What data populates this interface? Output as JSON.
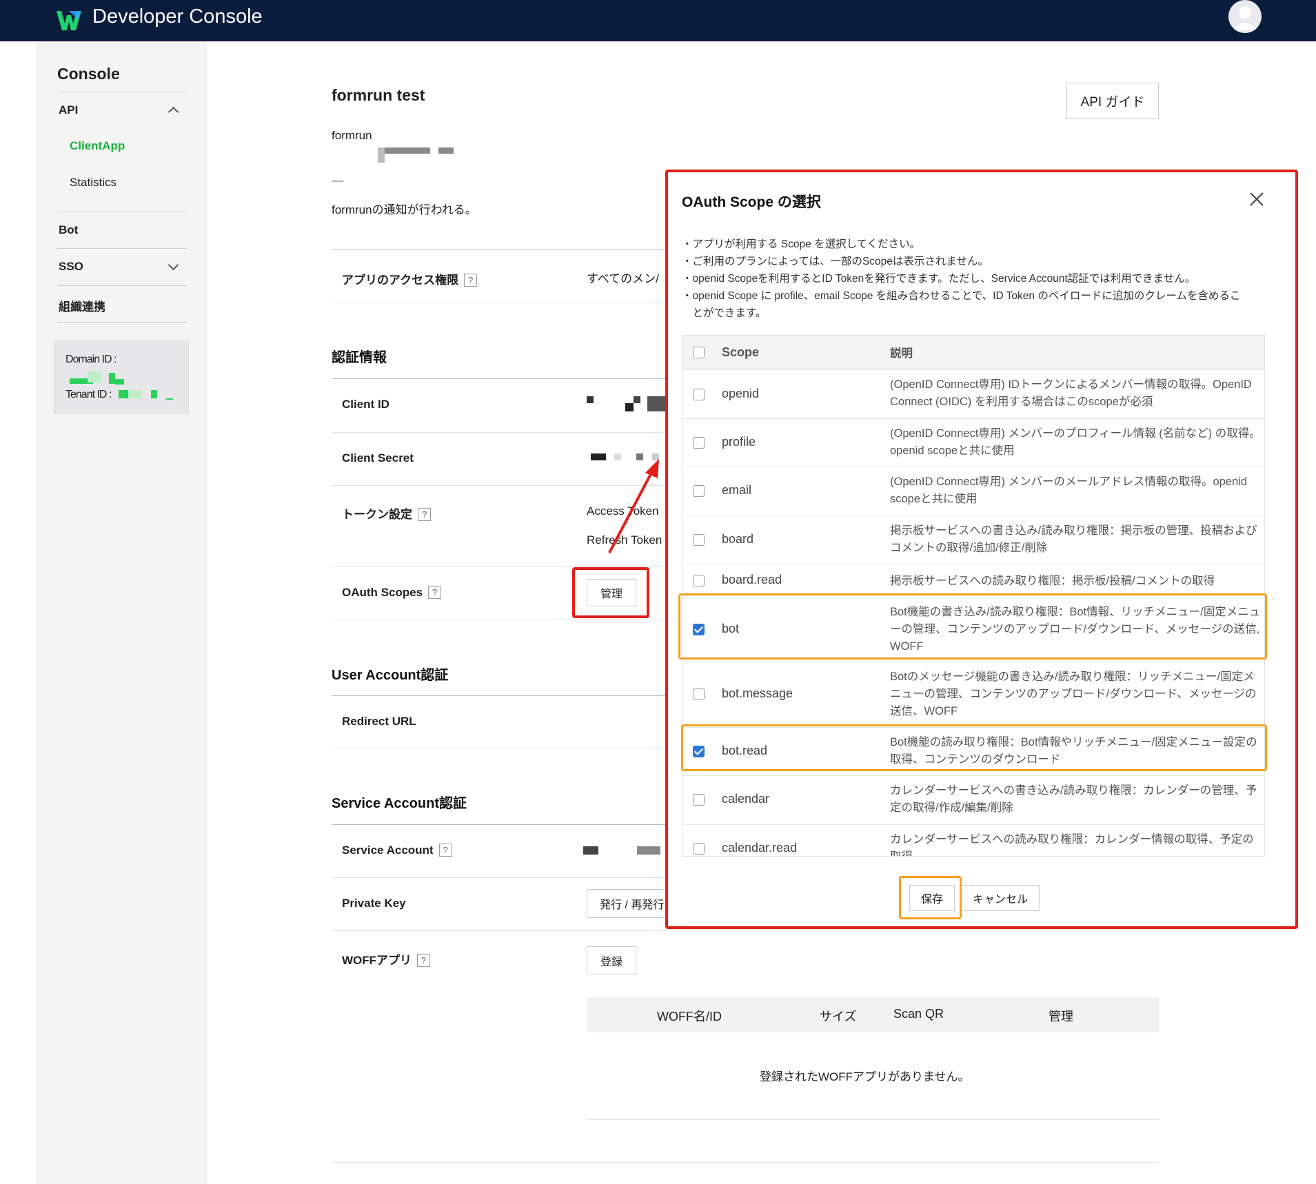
{
  "header": {
    "title": "Developer Console",
    "brand_color": "#0b1d3d",
    "logo_icon": "works-logo-icon",
    "avatar_icon": "user-avatar-icon"
  },
  "sidebar": {
    "title": "Console",
    "api": "API",
    "client_app": "ClientApp",
    "statistics": "Statistics",
    "bot": "Bot",
    "sso": "SSO",
    "org_link": "組織連携",
    "domain_id_label": "Domain ID :",
    "tenant_id_label": "Tenant ID :",
    "active_color": "#19b23b"
  },
  "app": {
    "name": "formrun test",
    "developer": "formrun",
    "dash": "—",
    "description": "formrunの通知が行われる。",
    "api_guide": "API ガイド"
  },
  "access": {
    "label": "アプリのアクセス権限",
    "value": "すべてのメン/"
  },
  "auth": {
    "title": "認証情報",
    "client_id": "Client ID",
    "client_secret": "Client Secret",
    "token_settings": "トークン設定",
    "access_token": "Access Token",
    "refresh_token": "Refresh Token",
    "oauth_scopes": "OAuth Scopes",
    "manage": "管理"
  },
  "user_account": {
    "title": "User Account認証",
    "redirect_url": "Redirect URL"
  },
  "service_account": {
    "title": "Service Account認証",
    "service_account": "Service Account",
    "private_key": "Private Key",
    "issue": "発行 / 再発行",
    "woff_app": "WOFFアプリ",
    "register": "登録"
  },
  "woff_table": {
    "columns": [
      "WOFF名/ID",
      "サイズ",
      "Scan QR",
      "管理"
    ],
    "empty": "登録されたWOFFアプリがありません。"
  },
  "modal": {
    "title": "OAuth Scope の選択",
    "notes": [
      "・アプリが利用する Scope を選択してください。",
      "・ご利用のプランによっては、一部のScopeは表示されません。",
      "・openid Scopeを利用するとID Tokenを発行できます。ただし、Service Account認証では利用できません。",
      "・openid Scope に profile、email Scope を組み合わせることで、ID Token のペイロードに追加のクレームを含めるこ",
      "　とができます。"
    ],
    "col_scope": "Scope",
    "col_desc": "説明",
    "rows": [
      {
        "scope": "openid",
        "checked": false,
        "desc": "(OpenID Connect専用) IDトークンによるメンバー情報の取得。OpenID Connect (OIDC) を利用する場合はこのscopeが必須"
      },
      {
        "scope": "profile",
        "checked": false,
        "desc": "(OpenID Connect専用) メンバーのプロフィール情報 (名前など) の取得。openid scopeと共に使用"
      },
      {
        "scope": "email",
        "checked": false,
        "desc": "(OpenID Connect専用) メンバーのメールアドレス情報の取得。openid scopeと共に使用"
      },
      {
        "scope": "board",
        "checked": false,
        "desc": "掲示板サービスへの書き込み/読み取り権限：掲示板の管理、投稿およびコメントの取得/追加/修正/削除"
      },
      {
        "scope": "board.read",
        "checked": false,
        "desc": "掲示板サービスへの読み取り権限：掲示板/投稿/コメントの取得"
      },
      {
        "scope": "bot",
        "checked": true,
        "desc": "Bot機能の書き込み/読み取り権限：Bot情報、リッチメニュー/固定メニューの管理、コンテンツのアップロード/ダウンロード、メッセージの送信, WOFF"
      },
      {
        "scope": "bot.message",
        "checked": false,
        "desc": "Botのメッセージ機能の書き込み/読み取り権限：リッチメニュー/固定メニューの管理、コンテンツのアップロード/ダウンロード、メッセージの送信、WOFF"
      },
      {
        "scope": "bot.read",
        "checked": true,
        "desc": "Bot機能の読み取り権限：Bot情報やリッチメニュー/固定メニュー設定の取得、コンテンツのダウンロード"
      },
      {
        "scope": "calendar",
        "checked": false,
        "desc": "カレンダーサービスへの書き込み/読み取り権限：カレンダーの管理、予定の取得/作成/編集/削除"
      },
      {
        "scope": "calendar.read",
        "checked": false,
        "desc": "カレンダーサービスへの読み取り権限：カレンダー情報の取得、予定の取得"
      }
    ],
    "save": "保存",
    "cancel": "キャンセル",
    "close_icon": "close-icon",
    "checkbox_color": "#2b77d6"
  },
  "annotations": {
    "red_color": "#e0201a",
    "orange_color": "#f5a020"
  }
}
